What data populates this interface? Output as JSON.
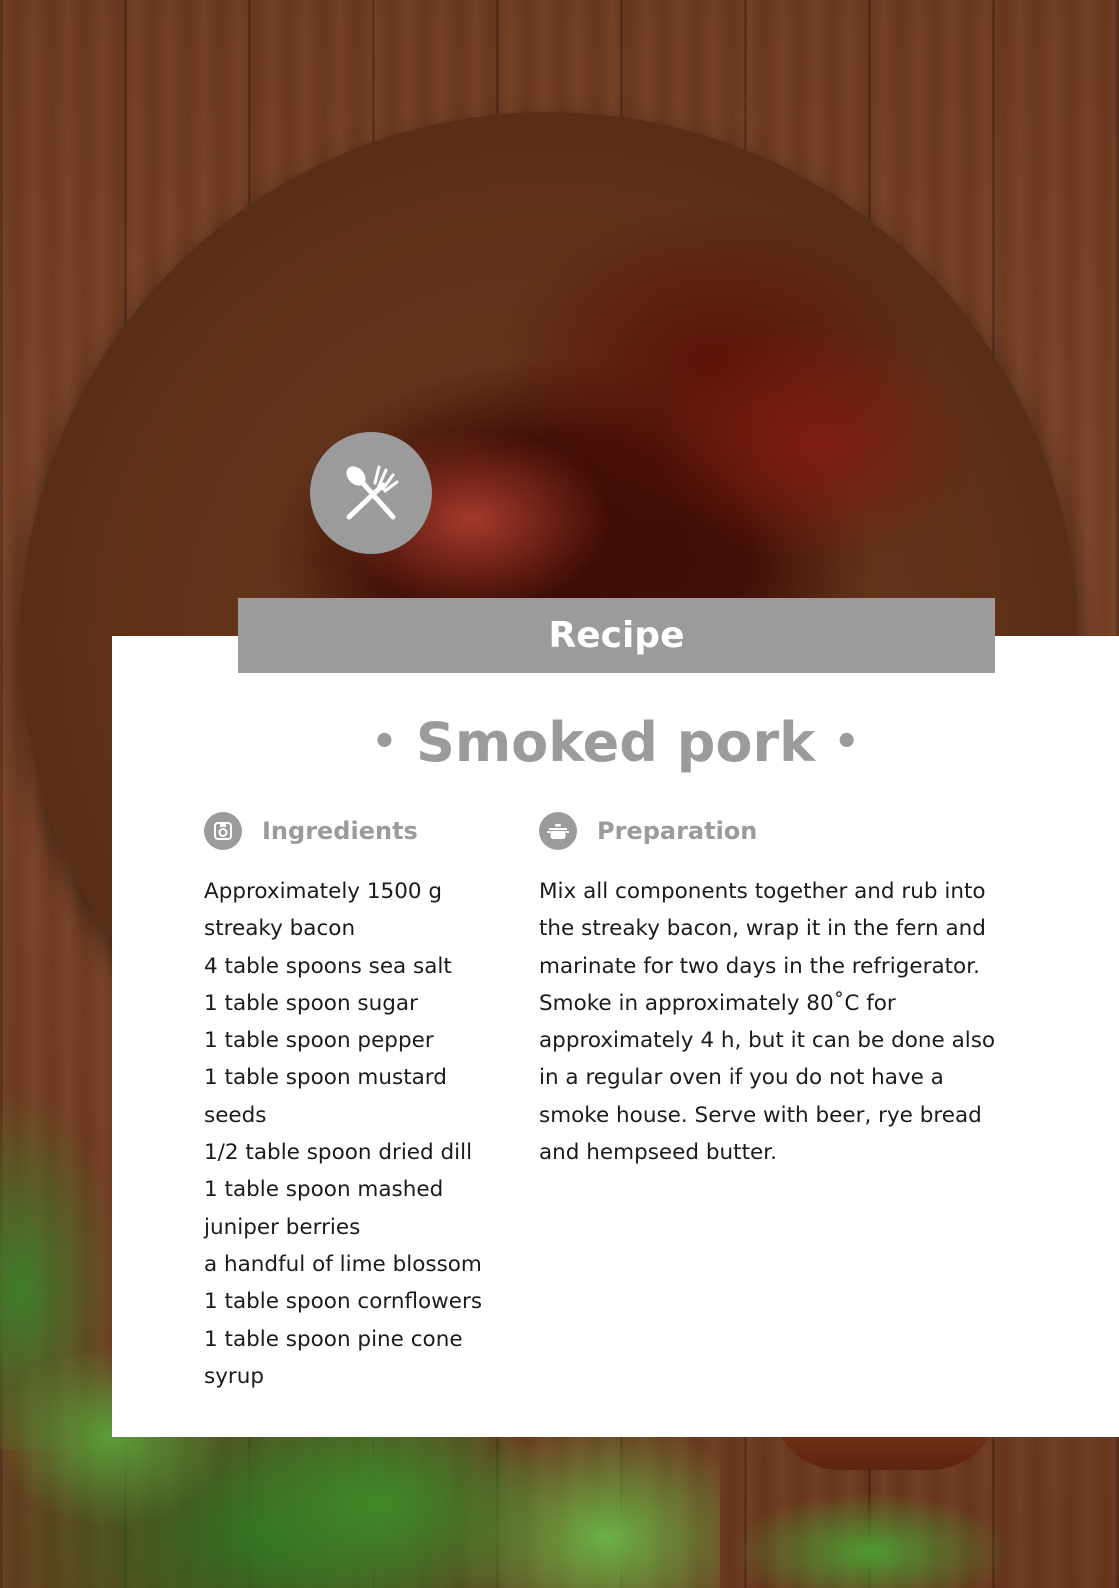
{
  "banner": {
    "label": "Recipe"
  },
  "recipe": {
    "title": "Smoked pork",
    "bullet": "•"
  },
  "ingredients": {
    "heading": "Ingredients",
    "icon": "kitchen-scale-icon",
    "items": [
      "Approximately 1500 g streaky bacon",
      "4 table spoons sea salt",
      "1 table spoon sugar",
      "1 table spoon pepper",
      "1 table spoon mustard seeds",
      "1/2 table spoon dried dill",
      "1 table spoon mashed juniper berries",
      "a handful of lime blossom",
      "1 table spoon cornflowers",
      "1 table spoon pine cone syrup"
    ]
  },
  "preparation": {
    "heading": "Preparation",
    "icon": "cooking-pot-icon",
    "text": "Mix all components together and rub into the streaky bacon, wrap it in the fern and marinate for two days in the refrigerator. Smoke in approximately 80˚C for approximately 4 h, but it can be done also in a regular oven if you do not have a smoke house. Serve with beer, rye bread and hempseed butter."
  },
  "colors": {
    "accent_gray": "#9b9b9b",
    "card": "#ffffff",
    "body_text": "#1b1b1b"
  }
}
